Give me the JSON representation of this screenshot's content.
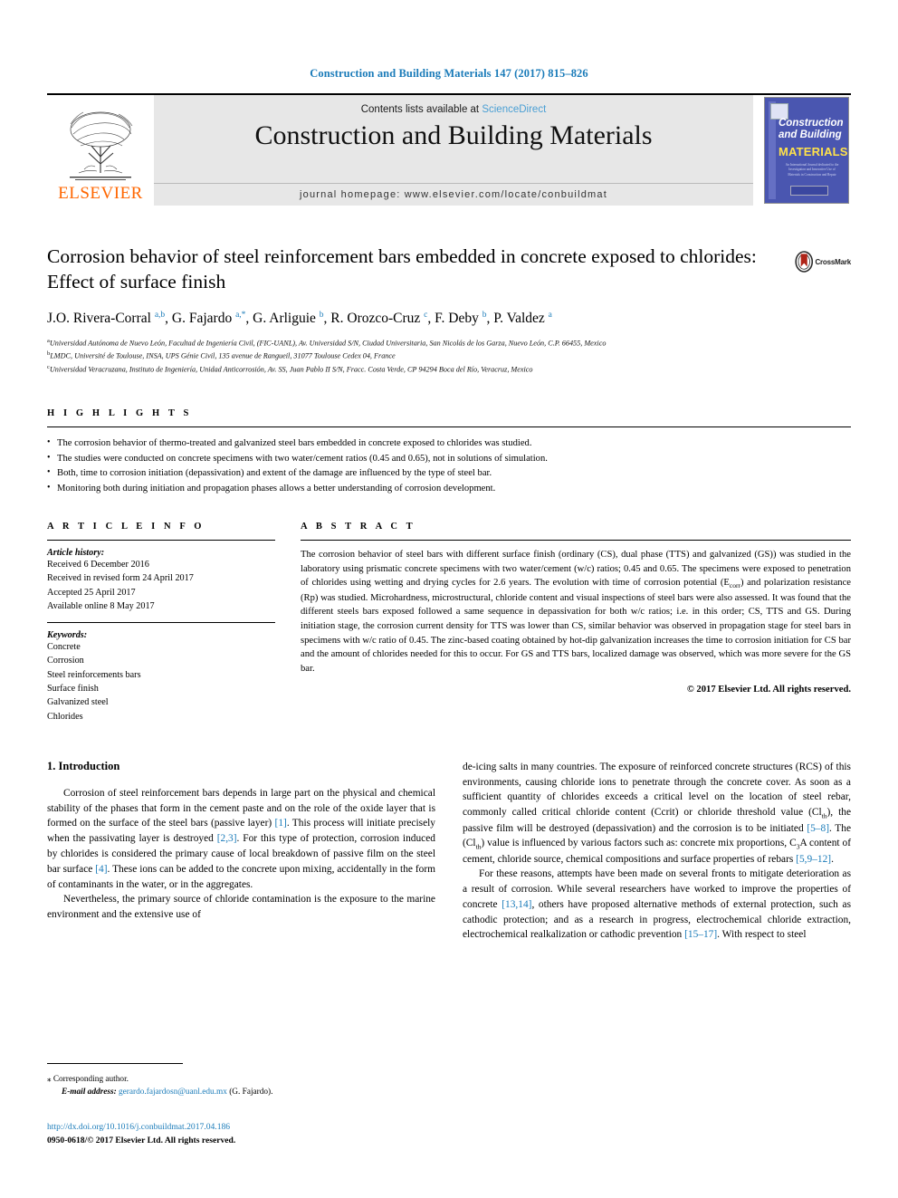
{
  "running_head": "Construction and Building Materials 147 (2017) 815–826",
  "masthead": {
    "publisher_name": "ELSEVIER",
    "contents_prefix": "Contents lists available at",
    "contents_link": "ScienceDirect",
    "journal_title": "Construction and Building Materials",
    "homepage_label": "journal homepage: www.elsevier.com/locate/conbuildmat",
    "cover": {
      "line1": "Construction",
      "line2": "and Building",
      "line3": "MATERIALS",
      "blurb": "An International Journal dedicated to the Investigation and Innovative Use of Materials in Construction and Repair"
    }
  },
  "crossmark": {
    "label": "CrossMark"
  },
  "article": {
    "title": "Corrosion behavior of steel reinforcement bars embedded in concrete exposed to chlorides: Effect of surface finish",
    "authors_html": "J.O. Rivera-Corral <sup>a,b</sup>, G. Fajardo <sup>a,*</sup>, G. Arliguie <sup>b</sup>, R. Orozco-Cruz <sup>c</sup>, F. Deby <sup>b</sup>, P. Valdez <sup>a</sup>",
    "affiliations": [
      {
        "marker": "a",
        "text": "Universidad Autónoma de Nuevo León, Facultad de Ingeniería Civil, (FIC-UANL), Av. Universidad S/N, Ciudad Universitaria, San Nicolás de los Garza, Nuevo León, C.P. 66455, Mexico"
      },
      {
        "marker": "b",
        "text": "LMDC, Université de Toulouse, INSA, UPS Génie Civil, 135 avenue de Rangueil, 31077 Toulouse Cedex 04, France"
      },
      {
        "marker": "c",
        "text": "Universidad Veracruzana, Instituto de Ingeniería, Unidad Anticorrosión, Av. SS, Juan Pablo II S/N, Fracc. Costa Verde, CP 94294 Boca del Río, Veracruz, Mexico"
      }
    ]
  },
  "highlights": {
    "heading": "H I G H L I G H T S",
    "items": [
      "The corrosion behavior of thermo-treated and galvanized steel bars embedded in concrete exposed to chlorides was studied.",
      "The studies were conducted on concrete specimens with two water/cement ratios (0.45 and 0.65), not in solutions of simulation.",
      "Both, time to corrosion initiation (depassivation) and extent of the damage are influenced by the type of steel bar.",
      "Monitoring both during initiation and propagation phases allows a better understanding of corrosion development."
    ]
  },
  "article_info": {
    "heading": "A R T I C L E    I N F O",
    "history_label": "Article history:",
    "history": [
      "Received 6 December 2016",
      "Received in revised form 24 April 2017",
      "Accepted 25 April 2017",
      "Available online 8 May 2017"
    ],
    "keywords_label": "Keywords:",
    "keywords": [
      "Concrete",
      "Corrosion",
      "Steel reinforcements bars",
      "Surface finish",
      "Galvanized steel",
      "Chlorides"
    ]
  },
  "abstract": {
    "heading": "A B S T R A C T",
    "text_html": "The corrosion behavior of steel bars with different surface finish (ordinary (CS), dual phase (TTS) and galvanized (GS)) was studied in the laboratory using prismatic concrete specimens with two water/cement (w/c) ratios; 0.45 and 0.65. The specimens were exposed to penetration of chlorides using wetting and drying cycles for 2.6 years. The evolution with time of corrosion potential (E<sub class=\"small\">corr</sub>) and polarization resistance (Rp) was studied. Microhardness, microstructural, chloride content and visual inspections of steel bars were also assessed. It was found that the different steels bars exposed followed a same sequence in depassivation for both w/c ratios; i.e. in this order; CS, TTS and GS. During initiation stage, the corrosion current density for TTS was lower than CS, similar behavior was observed in propagation stage for steel bars in specimens with w/c ratio of 0.45. The zinc-based coating obtained by hot-dip galvanization increases the time to corrosion initiation for CS bar and the amount of chlorides needed for this to occur. For GS and TTS bars, localized damage was observed, which was more severe for the GS bar.",
    "copyright": "© 2017 Elsevier Ltd. All rights reserved."
  },
  "body": {
    "section_title": "1. Introduction",
    "left_paragraphs_html": [
      "Corrosion of steel reinforcement bars depends in large part on the physical and chemical stability of the phases that form in the cement paste and on the role of the oxide layer that is formed on the surface of the steel bars (passive layer) <span class=\"ref\">[1]</span>. This process will initiate precisely when the passivating layer is destroyed <span class=\"ref\">[2,3]</span>. For this type of protection, corrosion induced by chlorides is considered the primary cause of local breakdown of passive film on the steel bar surface <span class=\"ref\">[4]</span>. These ions can be added to the concrete upon mixing, accidentally in the form of contaminants in the water, or in the aggregates.",
      "Nevertheless, the primary source of chloride contamination is the exposure to the marine environment and the extensive use of"
    ],
    "right_paragraphs_html": [
      "de-icing salts in many countries. The exposure of reinforced concrete structures (RCS) of this environments, causing chloride ions to penetrate through the concrete cover. As soon as a sufficient quantity of chlorides exceeds a critical level on the location of steel rebar, commonly called critical chloride content (Ccrit) or chloride threshold value (Cl<sub class=\"small\">th</sub>), the passive film will be destroyed (depassivation) and the corrosion is to be initiated <span class=\"ref\">[5–8]</span>. The (Cl<sub class=\"small\">th</sub>) value is influenced by various factors such as: concrete mix proportions, C<sub class=\"small\">3</sub>A content of cement, chloride source, chemical compositions and surface properties of rebars <span class=\"ref\">[5,9–12]</span>.",
      "For these reasons, attempts have been made on several fronts to mitigate deterioration as a result of corrosion. While several researchers have worked to improve the properties of concrete <span class=\"ref\">[13,14]</span>, others have proposed alternative methods of external protection, such as cathodic protection; and as a research in progress, electrochemical chloride extraction, electrochemical realkalization or cathodic prevention <span class=\"ref\">[15–17]</span>. With respect to steel"
    ]
  },
  "footer": {
    "corresponding_star": "⁎",
    "corresponding_label": "Corresponding author.",
    "email_label": "E-mail address:",
    "email": "gerardo.fajardosn@uanl.edu.mx",
    "email_owner": "(G. Fajardo).",
    "doi": "http://dx.doi.org/10.1016/j.conbuildmat.2017.04.186",
    "issn_line": "0950-0618/© 2017 Elsevier Ltd. All rights reserved."
  },
  "colors": {
    "link_blue": "#1a7bb9",
    "elsevier_orange": "#ff6600",
    "masthead_grey": "#e7e7e7",
    "crossmark_red": "#b02418"
  }
}
